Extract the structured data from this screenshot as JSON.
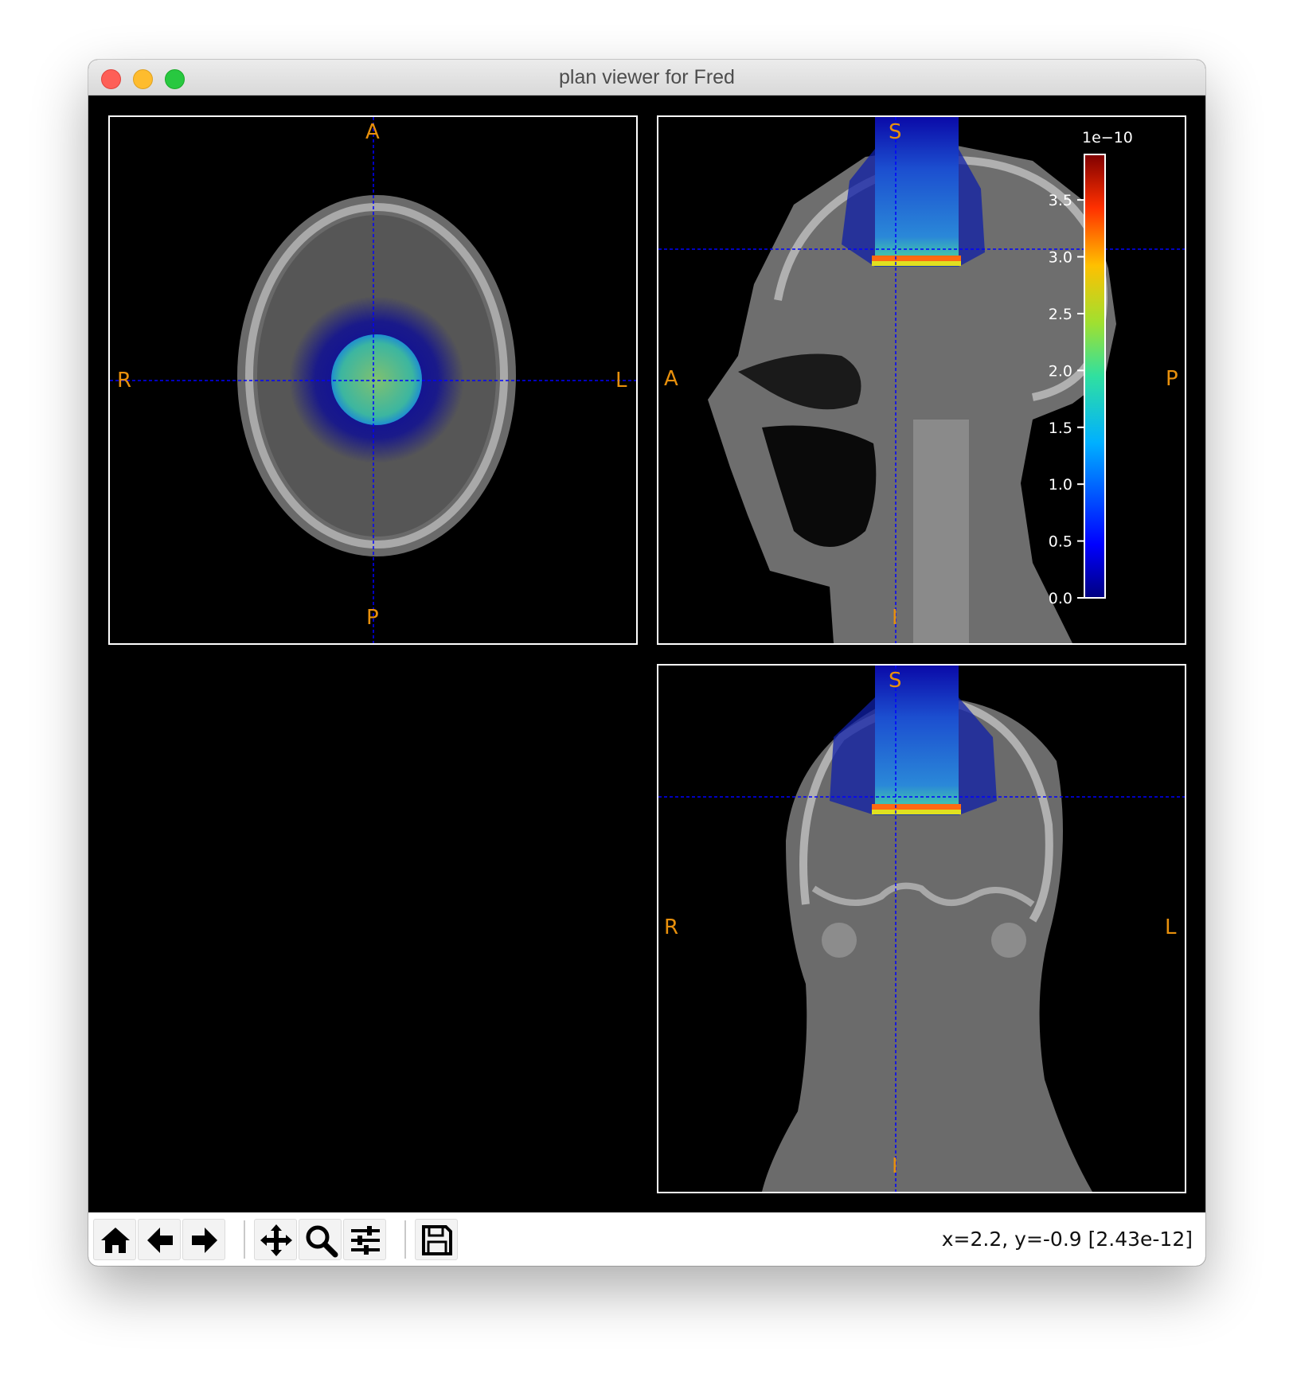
{
  "window": {
    "title": "plan viewer for Fred"
  },
  "panels": {
    "axial": {
      "top": "A",
      "bottom": "P",
      "left": "R",
      "right": "L"
    },
    "sagittal": {
      "top": "S",
      "bottom": "I",
      "left": "A",
      "right": "P"
    },
    "coronal": {
      "top": "S",
      "bottom": "I",
      "left": "R",
      "right": "L"
    }
  },
  "colorbar": {
    "exponent_label": "1e−10",
    "ticks": [
      "0.0",
      "0.5",
      "1.0",
      "1.5",
      "2.0",
      "2.5",
      "3.0",
      "3.5"
    ],
    "colormap": "jet"
  },
  "crosshair_color": "#0000ff",
  "toolbar": {
    "buttons": [
      "home-icon",
      "back-arrow-icon",
      "forward-arrow-icon",
      "pan-icon",
      "zoom-icon",
      "configure-subplots-icon",
      "save-icon"
    ],
    "status": "x=2.2, y=-0.9 [2.43e-12]"
  }
}
